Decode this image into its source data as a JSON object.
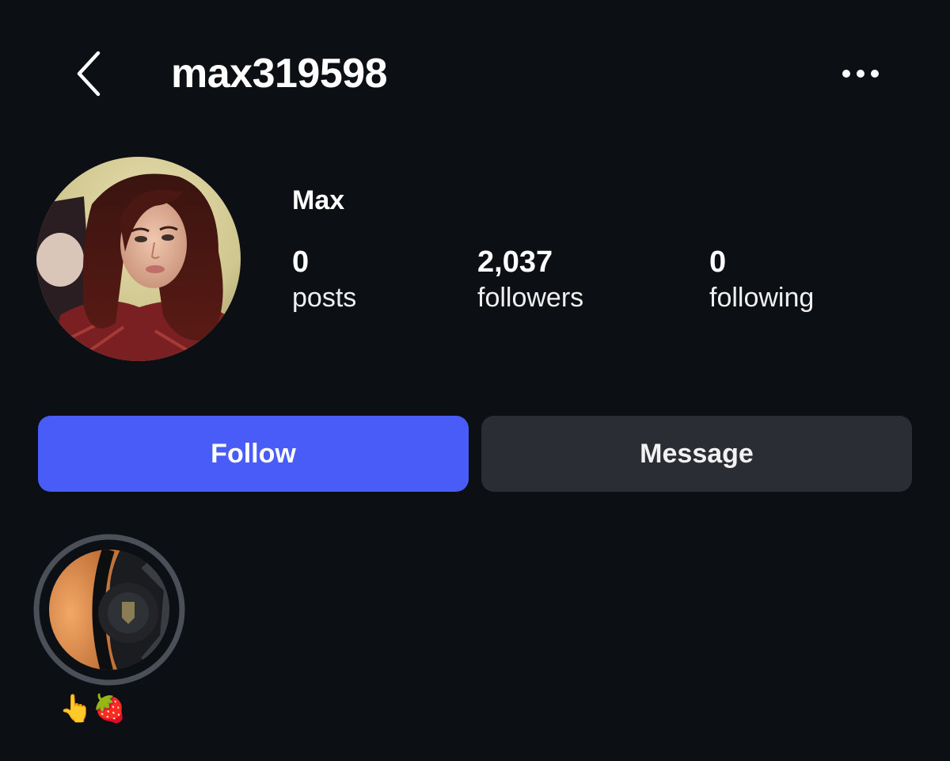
{
  "header": {
    "username": "max319598",
    "back_icon": "chevron-left-icon",
    "more_icon": "more-horizontal-icon"
  },
  "profile": {
    "display_name": "Max",
    "avatar_icon": "profile-photo",
    "stats": [
      {
        "count": "0",
        "label": "posts"
      },
      {
        "count": "2,037",
        "label": "followers"
      },
      {
        "count": "0",
        "label": "following"
      }
    ]
  },
  "actions": {
    "follow_label": "Follow",
    "message_label": "Message"
  },
  "highlights": [
    {
      "label": "👆🍓",
      "icon": "highlight-car-wheel-photo"
    }
  ],
  "colors": {
    "background": "#0c1014",
    "follow_button": "#4a5cf7",
    "message_button": "#2a2d33",
    "highlight_ring": "#4a4f58"
  }
}
